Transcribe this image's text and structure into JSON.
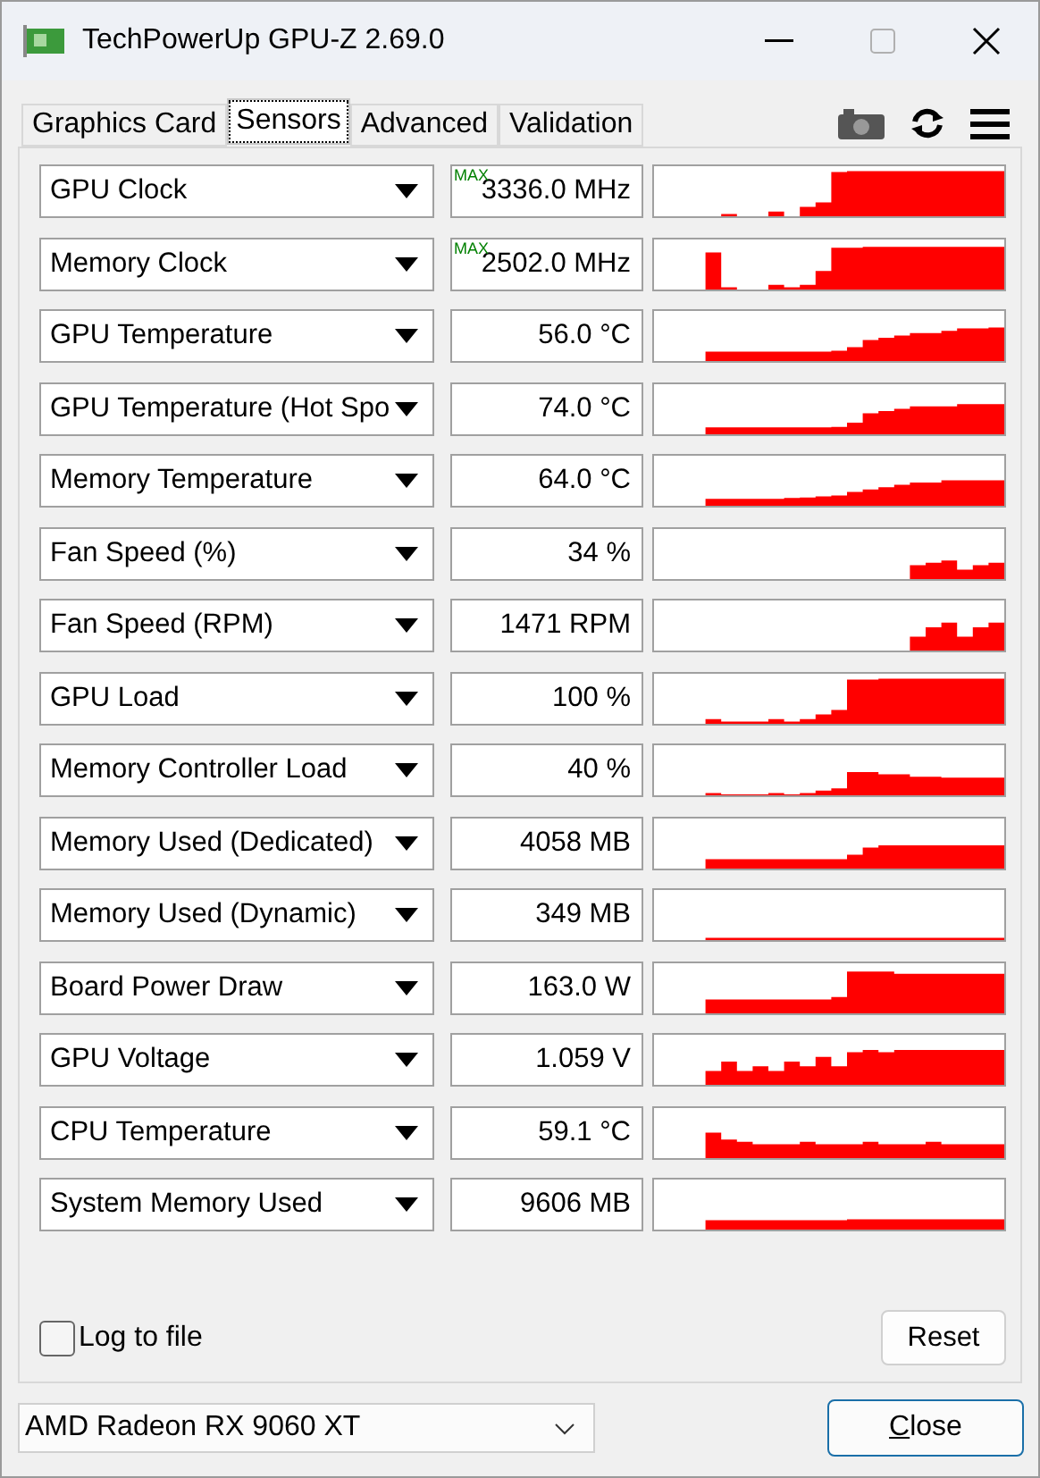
{
  "window": {
    "title": "TechPowerUp GPU-Z 2.69.0"
  },
  "tabs": [
    {
      "label": "Graphics Card",
      "selected": false
    },
    {
      "label": "Sensors",
      "selected": true
    },
    {
      "label": "Advanced",
      "selected": false
    },
    {
      "label": "Validation",
      "selected": false
    }
  ],
  "sensors": [
    {
      "name": "GPU Clock",
      "badge": "MAX",
      "value": "3336.0 MHz"
    },
    {
      "name": "Memory Clock",
      "badge": "MAX",
      "value": "2502.0 MHz"
    },
    {
      "name": "GPU Temperature",
      "value": "56.0 °C"
    },
    {
      "name": "GPU Temperature (Hot Spo",
      "value": "74.0 °C"
    },
    {
      "name": "Memory Temperature",
      "value": "64.0 °C"
    },
    {
      "name": "Fan Speed (%)",
      "value": "34 %"
    },
    {
      "name": "Fan Speed (RPM)",
      "value": "1471 RPM"
    },
    {
      "name": "GPU Load",
      "value": "100 %"
    },
    {
      "name": "Memory Controller Load",
      "value": "40 %"
    },
    {
      "name": "Memory Used (Dedicated)",
      "value": "4058 MB"
    },
    {
      "name": "Memory Used (Dynamic)",
      "value": "349 MB"
    },
    {
      "name": "Board Power Draw",
      "value": "163.0 W"
    },
    {
      "name": "GPU Voltage",
      "value": "1.059 V"
    },
    {
      "name": "CPU Temperature",
      "value": "59.1 °C"
    },
    {
      "name": "System Memory Used",
      "value": "9606 MB"
    }
  ],
  "log_to_file": {
    "label": "Log to file",
    "checked": false
  },
  "reset_button": "Reset",
  "device_select": {
    "value": "AMD Radeon RX 9060 XT"
  },
  "close_button": "Close"
}
